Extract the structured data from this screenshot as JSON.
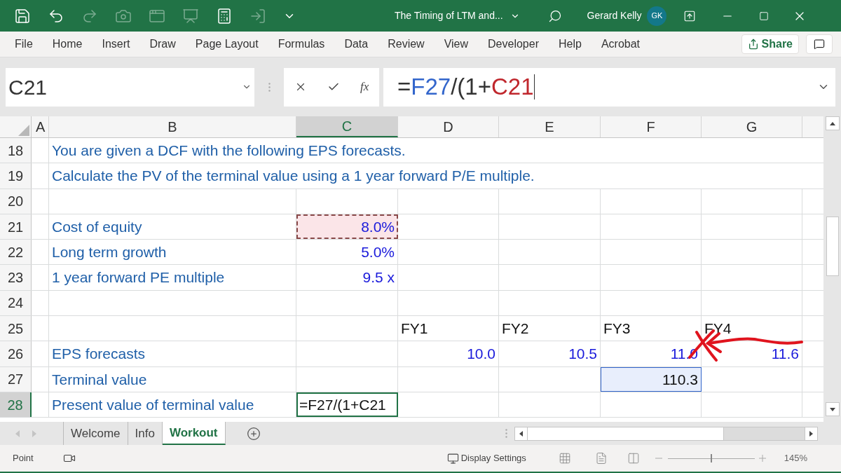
{
  "window": {
    "title": "The Timing of LTM and...",
    "user": "Gerard Kelly",
    "initials": "GK"
  },
  "ribbon_tabs": [
    "File",
    "Home",
    "Insert",
    "Draw",
    "Page Layout",
    "Formulas",
    "Data",
    "Review",
    "View",
    "Developer",
    "Help",
    "Acrobat"
  ],
  "share": "Share",
  "name_box": "C21",
  "function_label": "fx",
  "formula": [
    {
      "text": "=",
      "color": "#333333"
    },
    {
      "text": "F27",
      "color": "#3366cc"
    },
    {
      "text": "/(1+",
      "color": "#333333"
    },
    {
      "text": "C21",
      "color": "#c0272d"
    }
  ],
  "columns": [
    {
      "label": "A",
      "selected": false
    },
    {
      "label": "B",
      "selected": false
    },
    {
      "label": "C",
      "selected": true
    },
    {
      "label": "D",
      "selected": false
    },
    {
      "label": "E",
      "selected": false
    },
    {
      "label": "F",
      "selected": false
    },
    {
      "label": "G",
      "selected": false
    }
  ],
  "rows": [
    {
      "number": "18",
      "selected": false,
      "B": {
        "text": "You are given a DCF with the following EPS forecasts.",
        "kind": "note"
      }
    },
    {
      "number": "19",
      "selected": false,
      "B": {
        "text": "Calculate the PV of the terminal value using a 1 year forward P/E multiple.",
        "kind": "note"
      }
    },
    {
      "number": "20",
      "selected": false
    },
    {
      "number": "21",
      "selected": false,
      "B": {
        "text": "Cost of equity",
        "kind": "label"
      },
      "C": {
        "text": "8.0%",
        "kind": "input",
        "copy_outline": true
      }
    },
    {
      "number": "22",
      "selected": false,
      "B": {
        "text": "Long term growth",
        "kind": "label"
      },
      "C": {
        "text": "5.0%",
        "kind": "input"
      }
    },
    {
      "number": "23",
      "selected": false,
      "B": {
        "text": "1 year forward PE multiple",
        "kind": "label"
      },
      "C": {
        "text": "9.5 x",
        "kind": "input"
      }
    },
    {
      "number": "24",
      "selected": false
    },
    {
      "number": "25",
      "selected": false,
      "D": {
        "text": "FY1",
        "kind": "header"
      },
      "E": {
        "text": "FY2",
        "kind": "header"
      },
      "F": {
        "text": "FY3",
        "kind": "header"
      },
      "G": {
        "text": "FY4",
        "kind": "header"
      }
    },
    {
      "number": "26",
      "selected": false,
      "B": {
        "text": "EPS forecasts",
        "kind": "label"
      },
      "D": {
        "text": "10.0",
        "kind": "input"
      },
      "E": {
        "text": "10.5",
        "kind": "input"
      },
      "F": {
        "text": "11.0",
        "kind": "input"
      },
      "G": {
        "text": "11.6",
        "kind": "input"
      }
    },
    {
      "number": "27",
      "selected": false,
      "B": {
        "text": "Terminal value",
        "kind": "label"
      },
      "F": {
        "text": "110.3",
        "kind": "result",
        "reference_highlight": true
      }
    },
    {
      "number": "28",
      "selected": true,
      "B": {
        "text": "Present value of terminal value",
        "kind": "label"
      },
      "C": {
        "text": "=F27/(1+C21",
        "kind": "formula",
        "editing": true
      }
    }
  ],
  "sheet_tabs": [
    {
      "label": "Welcome",
      "selected": false
    },
    {
      "label": "Info",
      "selected": false
    },
    {
      "label": "Workout",
      "selected": true
    }
  ],
  "status": {
    "mode": "Point",
    "display_settings": "Display Settings",
    "zoom": "145%",
    "zoom_slider": {
      "level": 0.5
    }
  }
}
